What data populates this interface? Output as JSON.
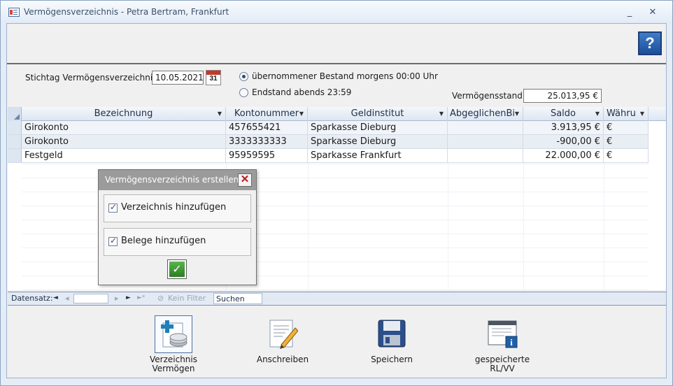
{
  "window": {
    "title": "Vermögensverzeichnis - Petra Bertram, Frankfurt",
    "minimize": "_",
    "close": "✕"
  },
  "help_button": "?",
  "header": {
    "stichtag_label": "Stichtag Vermögensverzeichnis:",
    "stichtag_value": "10.05.2021",
    "calendar_day": "31",
    "option_1": "übernommener Bestand morgens 00:00 Uhr",
    "option_2": "Endstand abends 23:59",
    "selected_option": 1,
    "total_label": "Vermögensstand:",
    "total_value": "25.013,95 €"
  },
  "table": {
    "columns": [
      "Bezeichnung",
      "Kontonummer",
      "Geldinstitut",
      "AbgeglichenBi",
      "Saldo",
      "Währu"
    ],
    "rows": [
      [
        "Girokonto",
        "457655421",
        "Sparkasse Dieburg",
        "",
        "3.913,95 €",
        "€"
      ],
      [
        "Girokonto",
        "3333333333",
        "Sparkasse Dieburg",
        "",
        "-900,00 €",
        "€"
      ],
      [
        "Festgeld",
        "95959595",
        "Sparkasse Frankfurt",
        "",
        "22.000,00 €",
        "€"
      ]
    ]
  },
  "navigation": {
    "record_label": "Datensatz:",
    "first": "◄",
    "prev": "◂",
    "next": "▸",
    "last": "►",
    "new": "►*",
    "filter_label": "Kein Filter",
    "search_label": "Suchen"
  },
  "footer_buttons": [
    {
      "label": "Verzeichnis\nVermögen",
      "icon": "document-add-coins-icon"
    },
    {
      "label": "Anschreiben",
      "icon": "letter-pencil-icon"
    },
    {
      "label": "Speichern",
      "icon": "floppy-disk-icon"
    },
    {
      "label": "gespeicherte\nRL/VV",
      "icon": "saved-window-info-icon"
    }
  ],
  "dialog": {
    "title": "Vermögensverzeichnis erstellen",
    "close": "✕",
    "check_1_label": "Verzeichnis hinzufügen",
    "check_1_checked": true,
    "check_2_label": "Belege hinzufügen",
    "check_2_checked": true,
    "ok": "✓"
  }
}
